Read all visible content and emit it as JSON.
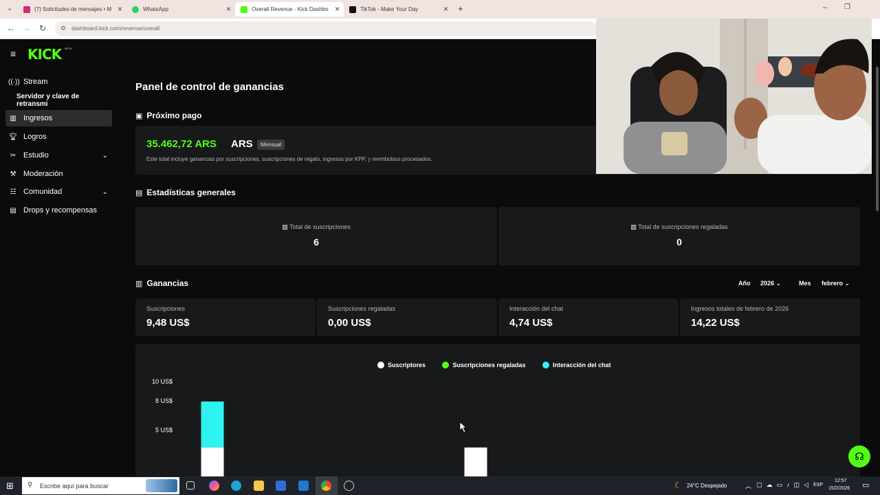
{
  "browser": {
    "tabs": [
      {
        "title": "(7) Solicitudes de mensajes • M",
        "color": "#d6287a"
      },
      {
        "title": "WhatsApp",
        "color": "#25d366"
      },
      {
        "title": "Overall Revenue - Kick Dashbo",
        "color": "#53fc18"
      },
      {
        "title": "TikTok - Make Your Day",
        "color": "#111111"
      }
    ],
    "url": "dashboard.kick.com/revenue/overall"
  },
  "brand": {
    "logo": "KICK",
    "beta": "BETA",
    "accent": "#53fc18"
  },
  "sidebar": {
    "items": [
      {
        "label": "Stream",
        "icon": "broadcast-icon"
      },
      {
        "label": "Servidor y clave de retransmi",
        "icon": ""
      },
      {
        "label": "Ingresos",
        "icon": "chart-icon"
      },
      {
        "label": "Logros",
        "icon": "trophy-icon"
      },
      {
        "label": "Estudio",
        "icon": "tools-icon"
      },
      {
        "label": "Moderación",
        "icon": "hammer-icon"
      },
      {
        "label": "Comunidad",
        "icon": "community-icon"
      },
      {
        "label": "Drops y recompensas",
        "icon": "gift-icon"
      }
    ]
  },
  "main": {
    "title": "Panel de control de ganancias",
    "next_payment": {
      "heading": "Próximo pago",
      "amount": "35.462,72 ARS",
      "currency": "ARS",
      "badge": "Mensual",
      "note": "Este total incluye ganancias por suscripciones, suscripciones de regalo, ingresos por KPP, y reembolsos procesados."
    },
    "stats": {
      "heading": "Estadísticas generales",
      "total_subs_label": "Total de suscripciones",
      "total_subs_value": "6",
      "gifted_subs_label": "Total de suscripciones regaladas",
      "gifted_subs_value": "0"
    },
    "earnings": {
      "heading": "Ganancias",
      "year_label": "Año",
      "year_value": "2026",
      "month_label": "Mes",
      "month_value": "febrero",
      "kpis": [
        {
          "label": "Suscripciones",
          "value": "9,48 US$"
        },
        {
          "label": "Suscripciones regaladas",
          "value": "0,00 US$"
        },
        {
          "label": "Interacción del chat",
          "value": "4,74 US$"
        },
        {
          "label": "Ingresos totales de febrero de 2026",
          "value": "14,22 US$"
        }
      ]
    }
  },
  "chart_data": {
    "type": "bar",
    "stacked": true,
    "series": [
      {
        "name": "Suscriptores",
        "color": "#ffffff",
        "values": [
          3.2,
          3.2
        ]
      },
      {
        "name": "Suscripciones regaladas",
        "color": "#53fc18",
        "values": [
          0,
          0
        ]
      },
      {
        "name": "Interacción del chat",
        "color": "#2ff3f0",
        "values": [
          4.74,
          0
        ]
      }
    ],
    "y_ticks": [
      "10 US$",
      "8 US$",
      "5 US$"
    ],
    "y_tick_values": [
      10,
      8,
      5
    ],
    "ylim": [
      0,
      10
    ]
  },
  "taskbar": {
    "search_placeholder": "Escribe aquí para buscar",
    "weather": "24°C Despejado",
    "lang": "ESP",
    "time": "12:57",
    "date": "15/2/2026"
  }
}
